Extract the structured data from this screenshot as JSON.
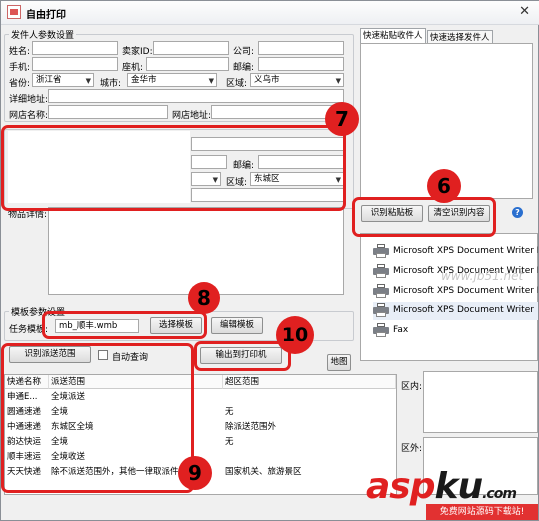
{
  "window": {
    "title": "自由打印"
  },
  "sender": {
    "group_title": "发件人参数设置",
    "name_label": "姓名:",
    "seller_id_label": "卖家ID:",
    "company_label": "公司:",
    "mobile_label": "手机:",
    "landline_label": "座机:",
    "zip_label": "邮编:",
    "province_label": "省份:",
    "province_value": "浙江省",
    "city_label": "城市:",
    "city_value": "金华市",
    "district_label": "区域:",
    "district_value": "义乌市",
    "address_label": "详细地址:",
    "shop_name_label": "网店名称:",
    "shop_url_label": "网店地址:"
  },
  "receiver": {
    "zip_label": "邮编:",
    "district_label": "区域:",
    "district_value": "东城区",
    "goods_label": "物品详情:"
  },
  "right_tabs": [
    {
      "label": "快速粘贴收件人"
    },
    {
      "label": "快速选择发件人"
    }
  ],
  "paste": {
    "recognize_button": "识别粘贴板",
    "clear_button": "清空识别内容"
  },
  "printers": [
    "Microsoft XPS Document Writer P",
    "Microsoft XPS Document Writer P",
    "Microsoft XPS Document Writer P",
    "Microsoft XPS Document Writer",
    "Fax"
  ],
  "template": {
    "group_title": "模板参数设置",
    "task_label": "任务模板:",
    "task_value": "mb_顺丰.wmb",
    "select_button": "选择模板",
    "edit_button": "编辑模板"
  },
  "actions": {
    "recognize_range_button": "识别派送范围",
    "auto_query_label": "自动查询",
    "print_button": "输出到打印机",
    "map_button": "地图"
  },
  "table": {
    "headers": [
      "快递名称",
      "派送范围",
      "超区范围"
    ],
    "rows": [
      [
        "申通E...",
        "全境派送",
        ""
      ],
      [
        "圆通速递",
        "全境",
        "无"
      ],
      [
        "中通速递",
        "东城区全境",
        "除派送范围外"
      ],
      [
        "韵达快运",
        "全境",
        "无"
      ],
      [
        "顺丰速运",
        "全境收送",
        ""
      ],
      [
        "天天快递",
        "除不派送范围外，其他一律取派件",
        "国家机关、旅游景区"
      ]
    ]
  },
  "range": {
    "inside_label": "区内:",
    "outside_label": "区外:"
  },
  "badges": [
    "7",
    "6",
    "8",
    "10",
    "9"
  ],
  "watermark": {
    "brand_a": "asp",
    "brand_b": "ku",
    "brand_c": ".com",
    "tagline": "免费网站源码下载站!",
    "site": "www.jb51.net"
  }
}
